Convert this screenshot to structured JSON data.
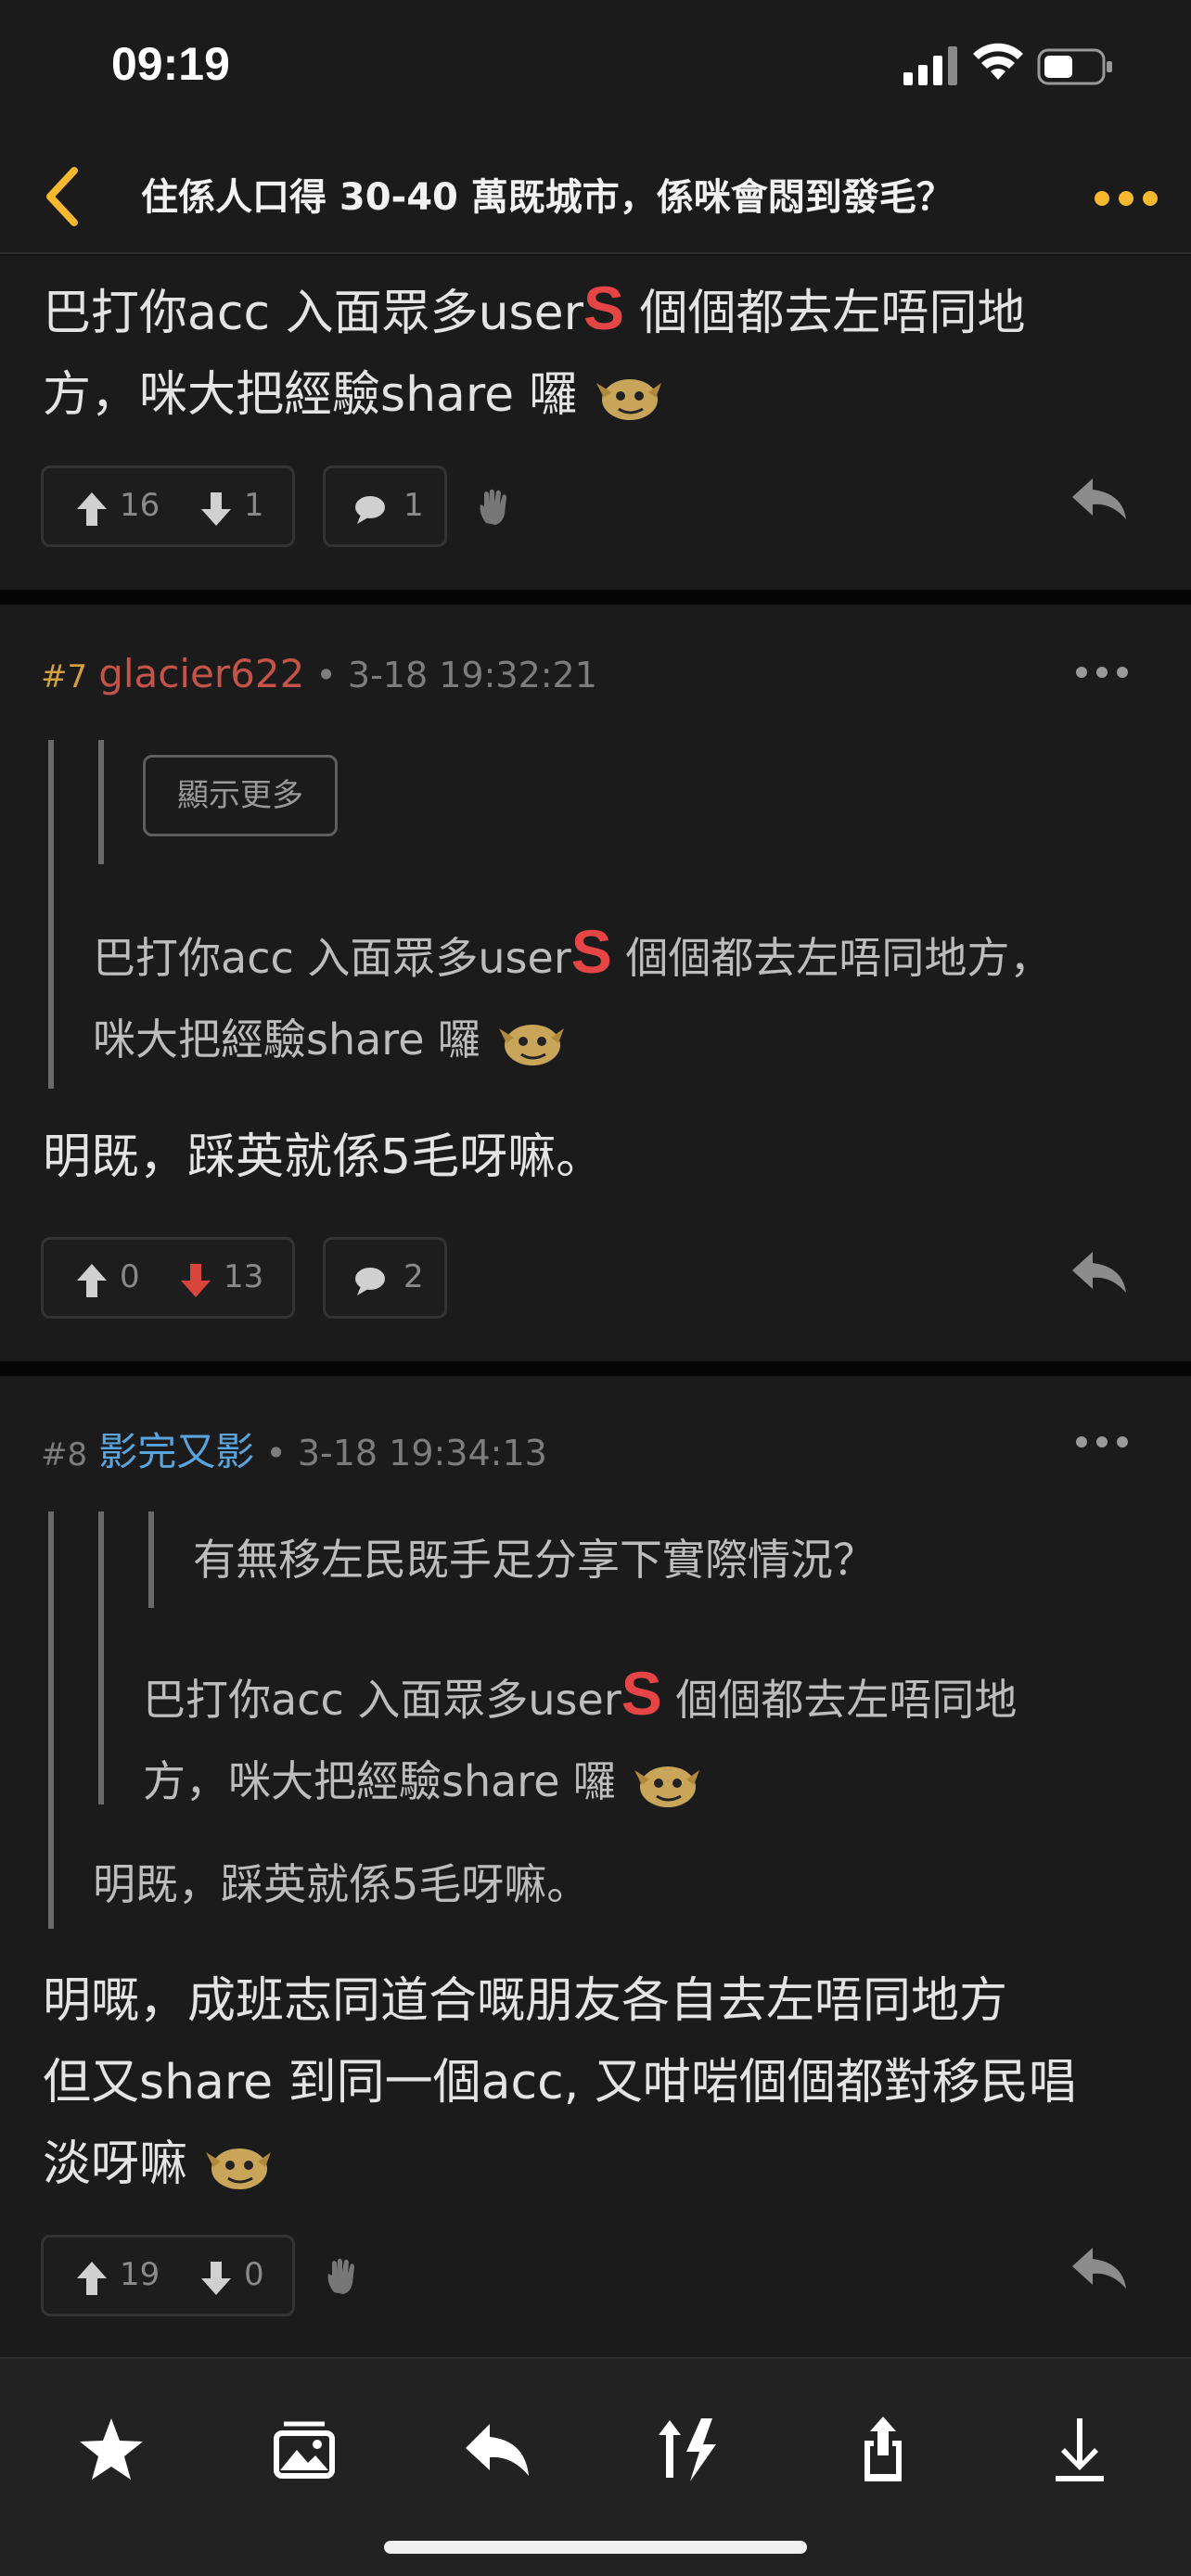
{
  "status": {
    "time": "09:19"
  },
  "nav": {
    "title": "住係人口得 30-40 萬既城市，係咪會悶到發毛？"
  },
  "post_top": {
    "line1_pre": "巴打你acc 入面眾多user",
    "line1_s": "S",
    "line1_post": " 個個都去左唔同地",
    "line2": "方，咪大把經驗share 囉",
    "upvotes": "16",
    "downvotes": "1",
    "comments": "1"
  },
  "post7": {
    "floor": "#7",
    "username": "glacier622",
    "timestamp": "• 3-18 19:32:21",
    "show_more": "顯示更多",
    "quote_line1_pre": "巴打你acc 入面眾多user",
    "quote_line1_s": "S",
    "quote_line1_post": " 個個都去左唔同地方，",
    "quote_line2": "咪大把經驗share 囉",
    "body": "明既，踩英就係5毛呀嘛。",
    "upvotes": "0",
    "downvotes": "13",
    "comments": "2"
  },
  "post8": {
    "floor": "#8",
    "username": "影完又影",
    "timestamp": "• 3-18 19:34:13",
    "quote3": "有無移左民既手足分享下實際情況？",
    "quote2_line1_pre": "巴打你acc 入面眾多user",
    "quote2_line1_s": "S",
    "quote2_line1_post": " 個個都去左唔同地",
    "quote2_line2": "方，咪大把經驗share 囉",
    "quote1": "明既，踩英就係5毛呀嘛。",
    "body_line1": "明嘅，成班志同道合嘅朋友各自去左唔同地方",
    "body_line2": "但又share 到同一個acc, 又咁啱個個都對移民唱",
    "body_line3": "淡呀嘛",
    "upvotes": "19",
    "downvotes": "0"
  },
  "colors": {
    "accent": "#f5b82e",
    "downvote_active": "#d9453a",
    "username_red": "#c65348",
    "username_blue": "#5aa4dd"
  },
  "toolbar": [
    "star-icon",
    "gallery-icon",
    "reply-icon",
    "sort-icon",
    "share-icon",
    "download-icon"
  ]
}
